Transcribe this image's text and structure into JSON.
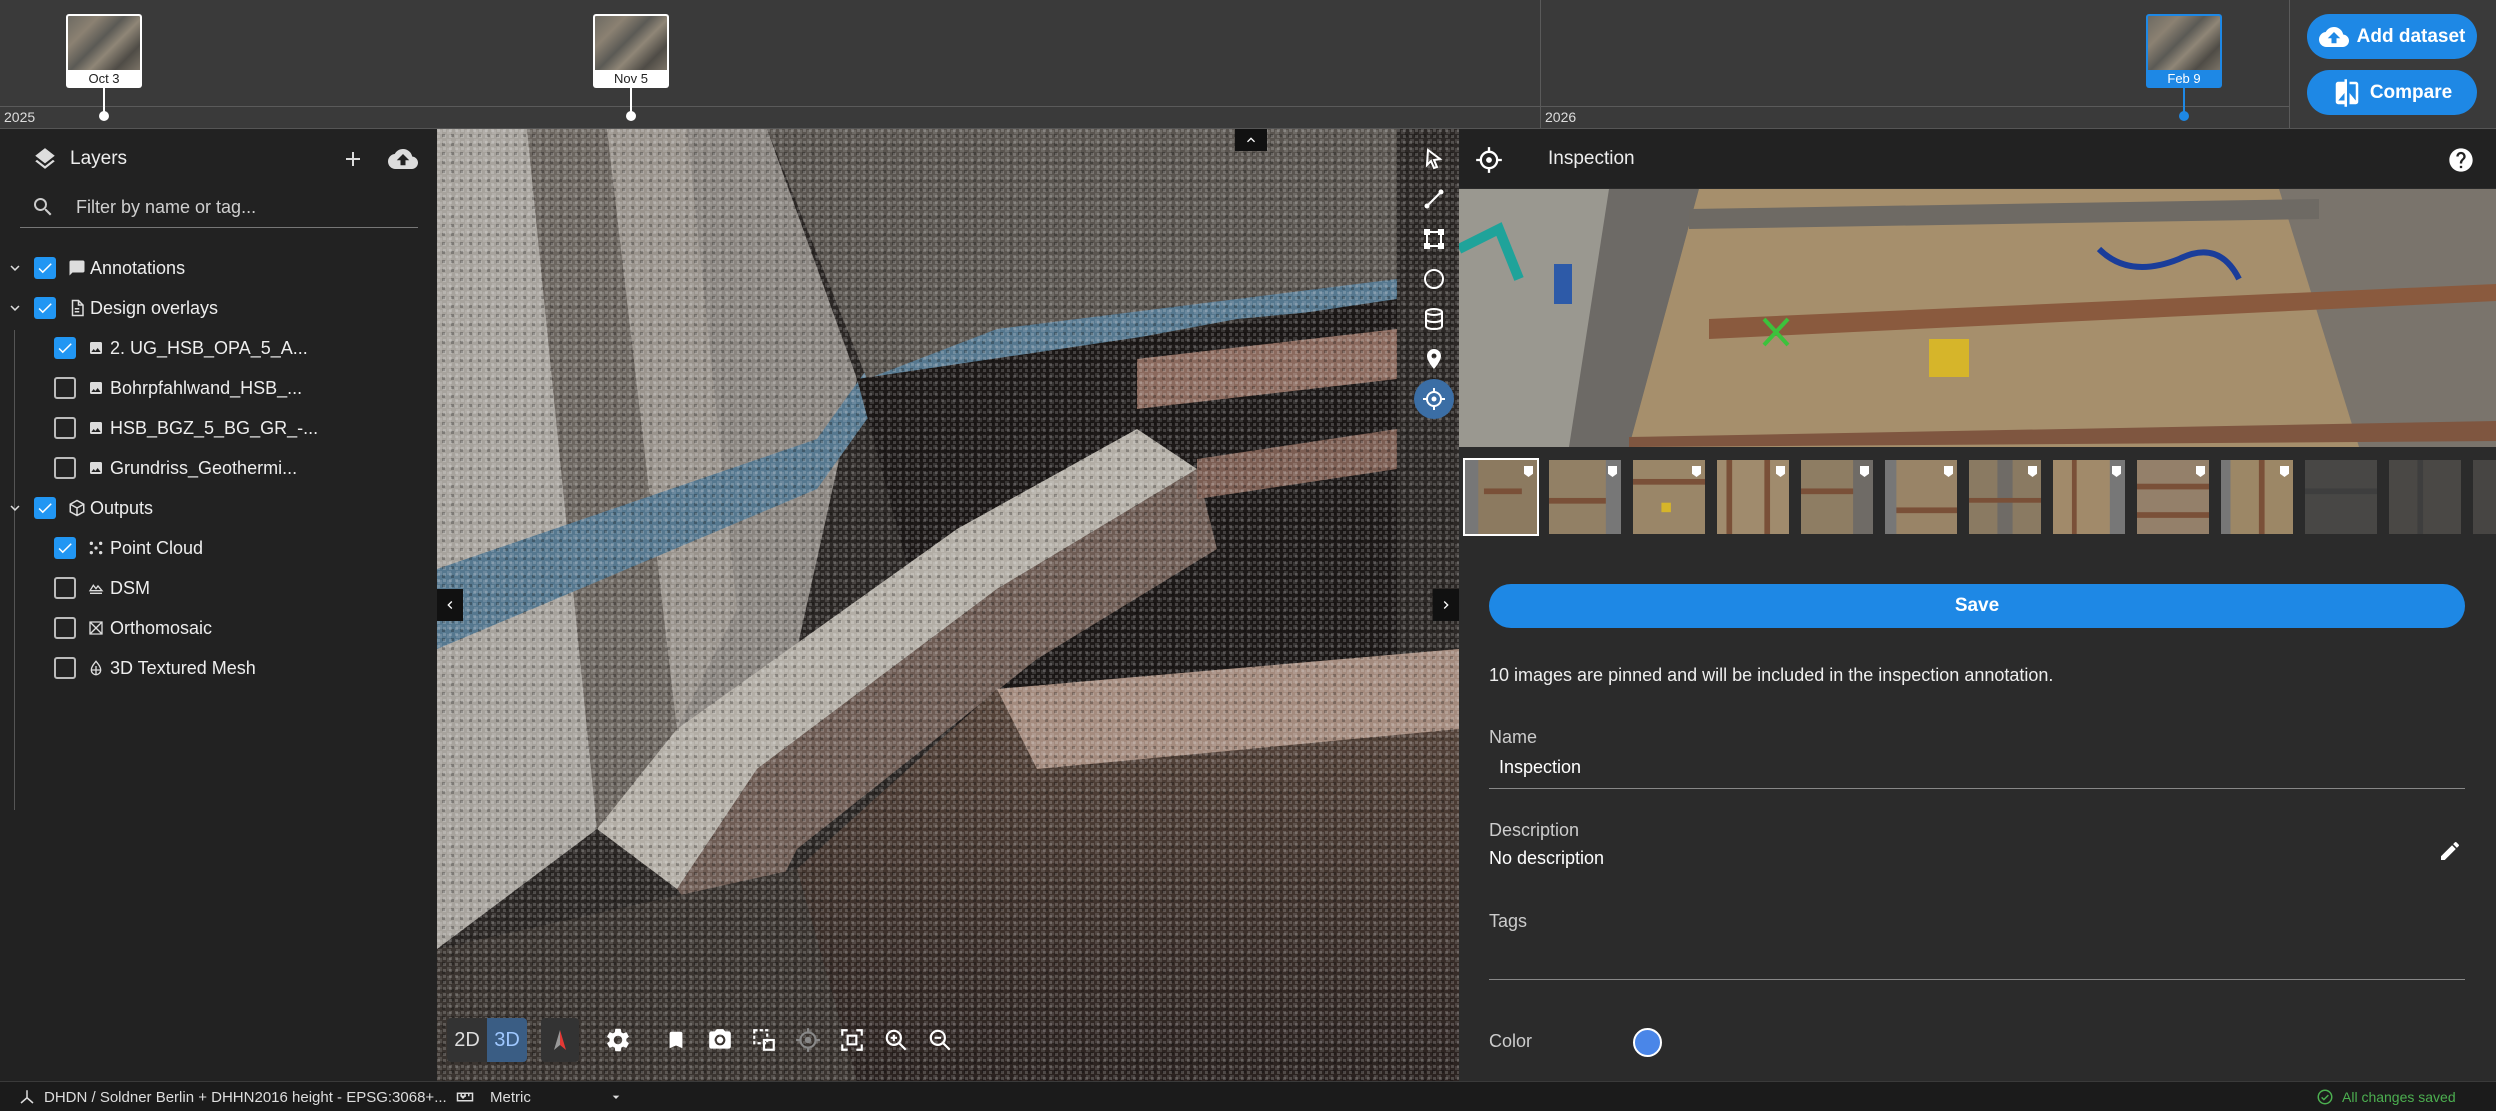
{
  "timeline": {
    "year_left": "2025",
    "year_right": "2026",
    "items": [
      {
        "date": "Oct 3",
        "selected": false
      },
      {
        "date": "Nov 5",
        "selected": false
      },
      {
        "date": "Feb 9",
        "selected": true
      }
    ],
    "add_dataset_label": "Add dataset",
    "compare_label": "Compare"
  },
  "layers": {
    "title": "Layers",
    "filter_placeholder": "Filter by name or tag...",
    "groups": [
      {
        "label": "Annotations",
        "checked": true,
        "icon": "comment-icon"
      },
      {
        "label": "Design overlays",
        "checked": true,
        "icon": "document-icon",
        "children": [
          {
            "label": "2. UG_HSB_OPA_5_A...",
            "checked": true,
            "icon": "image-icon"
          },
          {
            "label": "Bohrpfahlwand_HSB_...",
            "checked": false,
            "icon": "image-icon"
          },
          {
            "label": "HSB_BGZ_5_BG_GR_-...",
            "checked": false,
            "icon": "image-icon"
          },
          {
            "label": "Grundriss_Geothermi...",
            "checked": false,
            "icon": "image-icon"
          }
        ]
      },
      {
        "label": "Outputs",
        "checked": true,
        "icon": "cube-icon",
        "children": [
          {
            "label": "Point Cloud",
            "checked": true,
            "icon": "point-cloud-icon"
          },
          {
            "label": "DSM",
            "checked": false,
            "icon": "dsm-icon"
          },
          {
            "label": "Orthomosaic",
            "checked": false,
            "icon": "orthomosaic-icon"
          },
          {
            "label": "3D Textured Mesh",
            "checked": false,
            "icon": "mesh-icon"
          }
        ]
      }
    ]
  },
  "viewer": {
    "mode_2d": "2D",
    "mode_3d": "3D",
    "active_mode": "3D",
    "draw_tools": [
      "select-tool-icon",
      "line-tool-icon",
      "polygon-tool-icon",
      "circle-tool-icon",
      "volume-tool-icon",
      "marker-tool-icon",
      "inspection-tool-icon"
    ],
    "active_tool": "inspection-tool-icon"
  },
  "inspection": {
    "title": "Inspection",
    "thumbnail_count": 12,
    "pinned_count": 10,
    "save_label": "Save",
    "pinned_message": "10 images are pinned and will be included in the inspection annotation.",
    "name_label": "Name",
    "name_value": "Inspection",
    "description_label": "Description",
    "description_value": "No description",
    "tags_label": "Tags",
    "tags_value": "",
    "color_label": "Color",
    "color_value": "#4a86e8"
  },
  "statusbar": {
    "crs": "DHDN / Soldner Berlin + DHHN2016 height - EPSG:3068+...",
    "units": "Metric",
    "save_status": "All changes saved"
  },
  "colors": {
    "accent": "#1e88e5",
    "panel_bg": "#222222",
    "status_ok": "#4caf50"
  }
}
